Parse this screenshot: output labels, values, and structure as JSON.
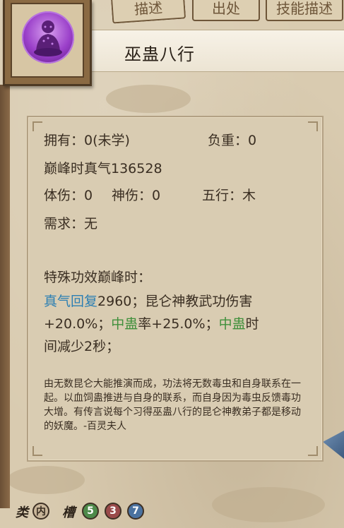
{
  "tabs": [
    "描述",
    "出处",
    "技能描述"
  ],
  "skill_name": "巫蛊八行",
  "stats": {
    "own": "拥有：0(未学)",
    "weight": "负重：0",
    "peak_qi": "巅峰时真气136528",
    "body_damage": "体伤：0",
    "spirit_damage": "神伤：0",
    "element": "五行：木",
    "requirement": "需求：无"
  },
  "effects": {
    "heading": "特殊功效巅峰时：",
    "line1_a": "真气回复",
    "line1_b": "2960；昆仑神教武功伤害",
    "line2_a": "+20.0%；",
    "line2_b": "中蛊",
    "line2_c": "率+25.0%；",
    "line2_d": "中蛊",
    "line2_e": "时",
    "line3": "间减少2秒；"
  },
  "lore": "由无数昆仑大能推演而成，功法将无数毒虫和自身联系在一起。以血饲蛊推进与自身的联系，而自身因为毒虫反馈毒功大增。有传言说每个习得巫蛊八行的昆仑神教弟子都是移动的妖魔。-百灵夫人",
  "bottom": {
    "type_label": "类",
    "type_value": "内",
    "slot_label": "槽",
    "slots": [
      "5",
      "3",
      "7"
    ]
  },
  "colors": {
    "blue_text": "#2c7fb3",
    "green_text": "#3f8f3b",
    "slot_green": "#4e8a4a",
    "slot_red": "#9a4a4a",
    "slot_blue": "#4a72a0"
  }
}
